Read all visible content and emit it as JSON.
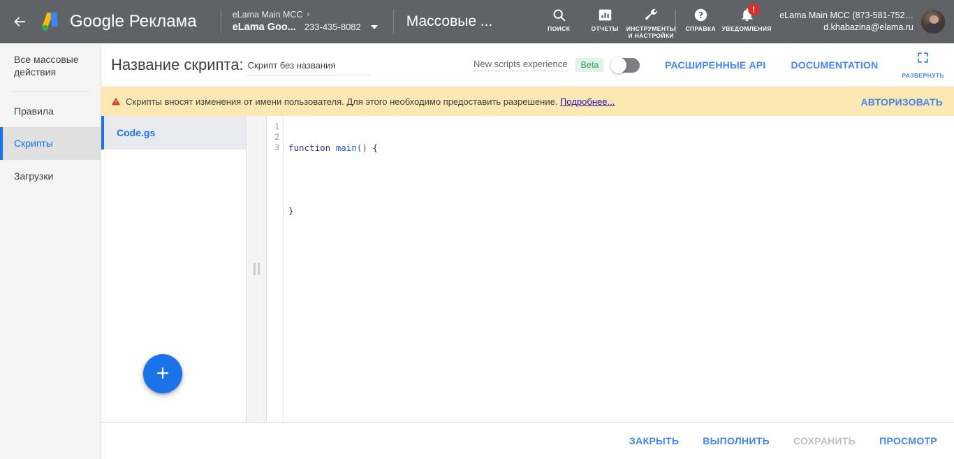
{
  "topbar": {
    "back_icon": "arrow-left-icon",
    "brand": "Google Реклама",
    "account": {
      "parent": "eLama Main MCC",
      "chevron": "›",
      "name": "eLama Goo...",
      "id": "233-435-8082"
    },
    "page_title": "Массовые ...",
    "nav": [
      {
        "icon": "search-icon",
        "label": "ПОИСК"
      },
      {
        "icon": "reports-bar-chart-icon",
        "label": "ОТЧЕТЫ"
      },
      {
        "icon": "wrench-tools-icon",
        "label": "ИНСТРУМЕНТЫ И НАСТРОЙКИ"
      },
      {
        "icon": "help-question-icon",
        "label": "СПРАВКА"
      },
      {
        "icon": "bell-notifications-icon",
        "label": "УВЕДОМЛЕНИЯ",
        "badge": "!"
      }
    ],
    "user": {
      "mcc": "eLama Main MCC (873-581-752…",
      "email": "d.khabazina@elama.ru"
    }
  },
  "sidebar": {
    "items": [
      {
        "label": "Все массовые действия",
        "active": false
      },
      {
        "label": "Правила",
        "active": false
      },
      {
        "label": "Скрипты",
        "active": true
      },
      {
        "label": "Загрузки",
        "active": false
      }
    ]
  },
  "script_header": {
    "label": "Название скрипта:",
    "name_value": "Скрипт без названия",
    "name_placeholder": "Скрипт без названия",
    "new_experience_label": "New scripts experience",
    "beta_badge": "Beta",
    "toggle_state": "off",
    "links": [
      "РАСШИРЕННЫЕ API",
      "DOCUMENTATION"
    ],
    "expand": {
      "icon": "fullscreen-expand-icon",
      "label": "РАЗВЕРНУТЬ"
    }
  },
  "warning": {
    "icon": "warning-triangle-icon",
    "text": "Скрипты вносят изменения от имени пользователя. Для этого необходимо предоставить разрешение.",
    "link": "Подробнее...",
    "cta": "АВТОРИЗОВАТЬ"
  },
  "files": {
    "items": [
      {
        "name": "Code.gs",
        "active": true
      }
    ],
    "add_button_icon": "plus-icon"
  },
  "splitter": {
    "icon": "drag-grip-icon"
  },
  "editor": {
    "line_numbers": [
      "1",
      "2",
      "3"
    ],
    "lines": [
      {
        "tokens": [
          {
            "t": "function",
            "c": "kw"
          },
          {
            "t": " ",
            "c": ""
          },
          {
            "t": "main",
            "c": "fn"
          },
          {
            "t": "()",
            "c": "pn"
          },
          {
            "t": " {",
            "c": ""
          }
        ]
      },
      {
        "tokens": []
      },
      {
        "tokens": [
          {
            "t": "}",
            "c": ""
          }
        ]
      }
    ],
    "plain_text": "function main() {\n\n}"
  },
  "bottom_bar": {
    "buttons": [
      {
        "label": "ЗАКРЫТЬ",
        "disabled": false
      },
      {
        "label": "ВЫПОЛНИТЬ",
        "disabled": false
      },
      {
        "label": "СОХРАНИТЬ",
        "disabled": true
      },
      {
        "label": "ПРОСМОТР",
        "disabled": false
      }
    ]
  },
  "colors": {
    "topbar_bg": "#5f6368",
    "accent_blue": "#4285f4",
    "link_blue": "#1a73e8",
    "warning_bg": "#fce8b2",
    "warning_icon": "#d93025",
    "badge_red": "#d93025",
    "beta_green": "#34a853",
    "disabled_gray": "#bdc1c6"
  }
}
